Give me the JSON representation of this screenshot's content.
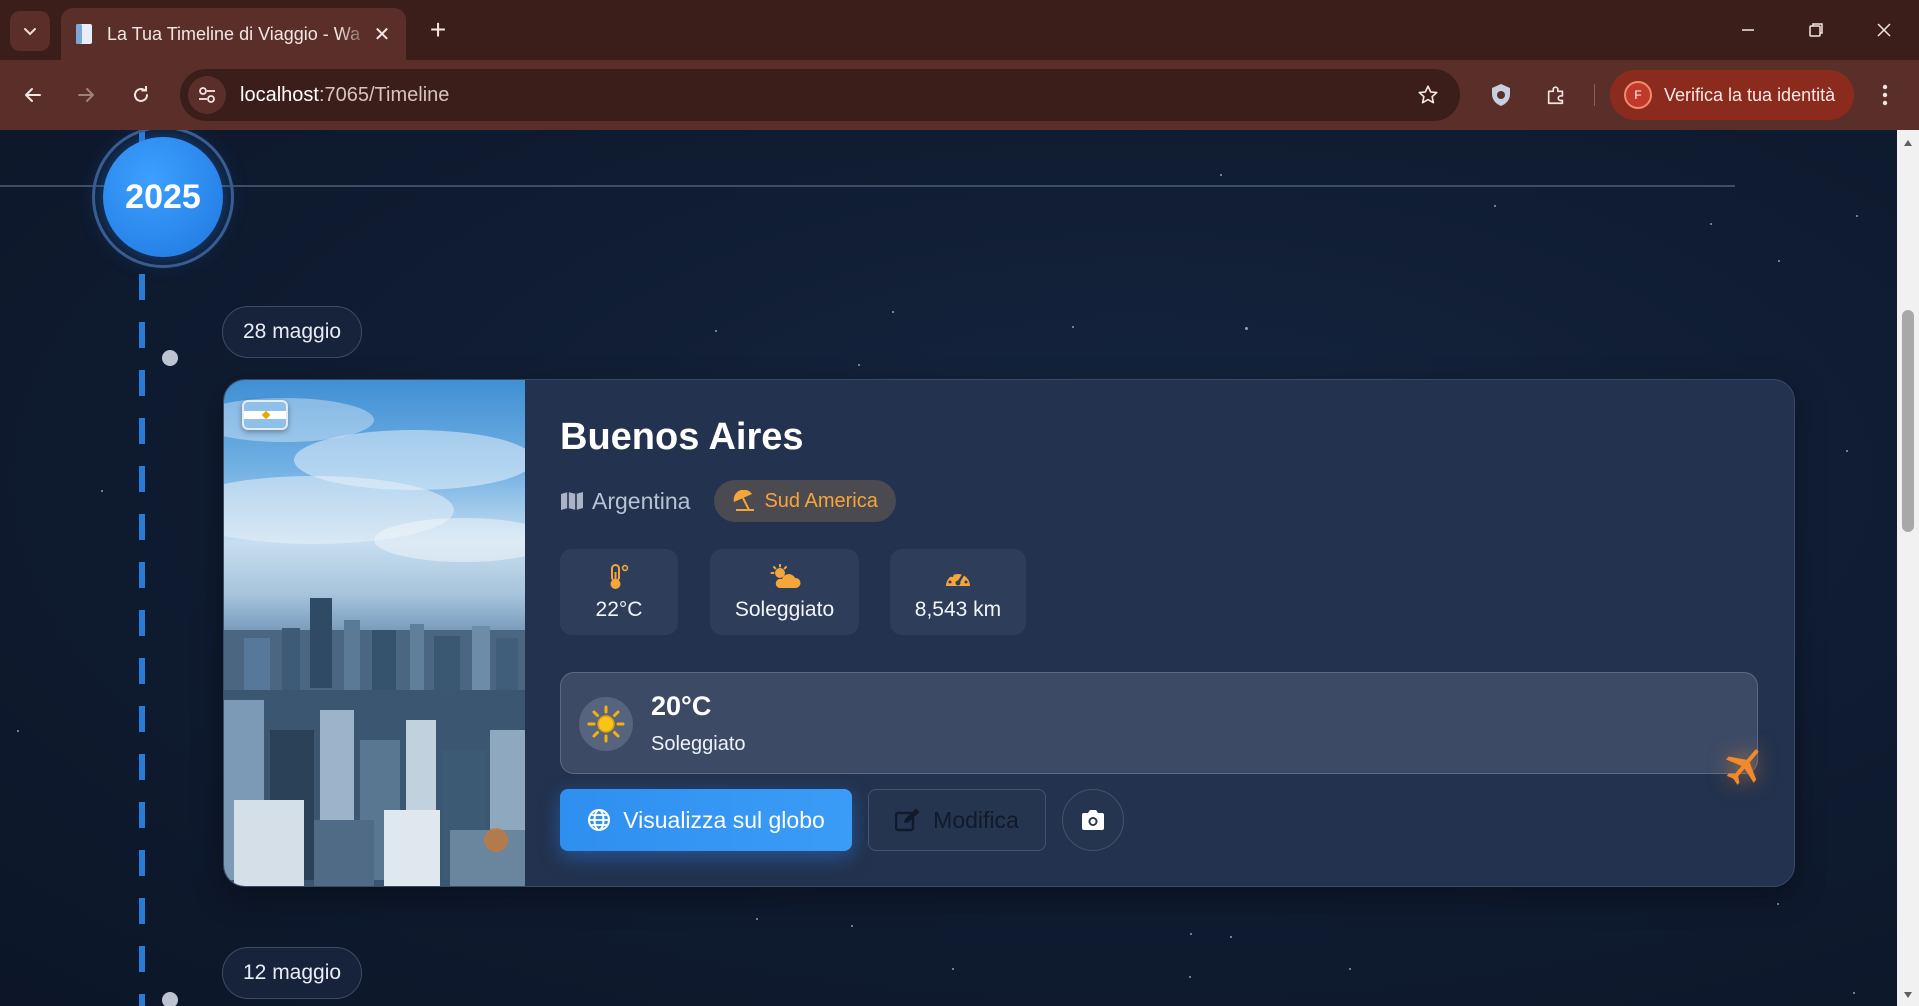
{
  "browser": {
    "tab_title": "La Tua Timeline di Viaggio - Wa",
    "url_host": "localhost",
    "url_path": ":7065/Timeline",
    "profile_label": "Verifica la tua identità",
    "profile_initial": "F"
  },
  "timeline": {
    "year": "2025",
    "entries": [
      {
        "date": "28 maggio",
        "city": "Buenos Aires",
        "country": "Argentina",
        "region": "Sud America",
        "stats": [
          {
            "icon": "thermometer-icon",
            "value": "22°C"
          },
          {
            "icon": "sun-behind-cloud-icon",
            "value": "Soleggiato"
          },
          {
            "icon": "gauge-icon",
            "value": "8,543 km"
          }
        ],
        "weather": {
          "temp": "20°C",
          "desc": "Soleggiato",
          "icon": "sun-icon"
        },
        "actions": {
          "globe": "Visualizza sul globo",
          "edit": "Modifica"
        }
      },
      {
        "date": "12 maggio"
      }
    ]
  },
  "colors": {
    "accent_blue": "#2f8ff0",
    "region_orange": "#f5a63b",
    "card_bg": "#23324e",
    "page_bg": "#0f1b30"
  }
}
